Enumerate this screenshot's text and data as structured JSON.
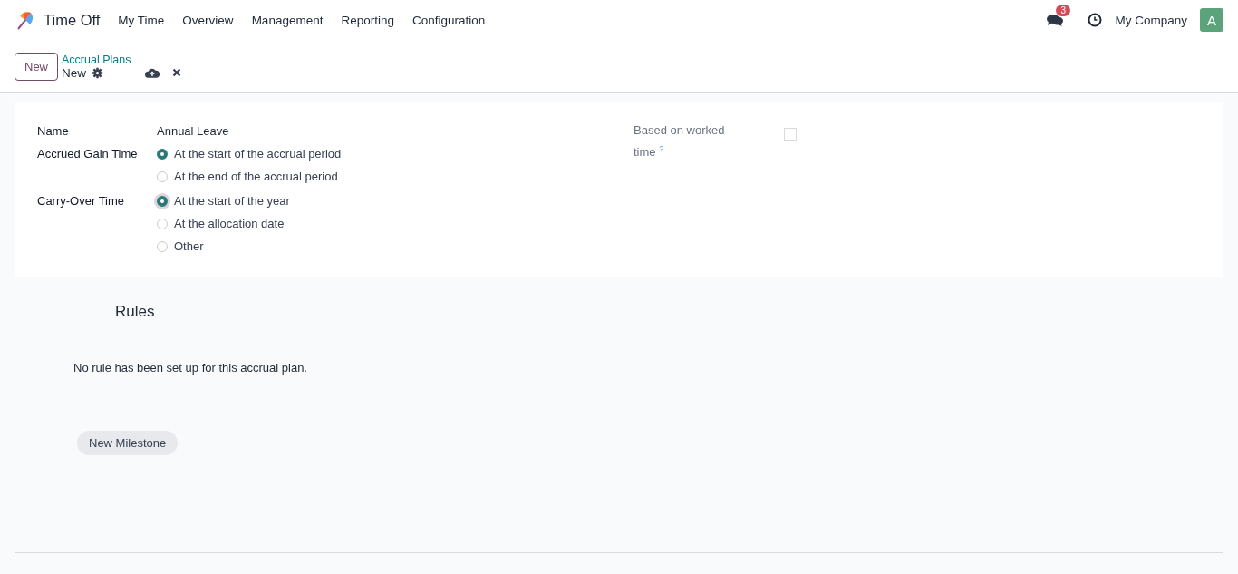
{
  "navbar": {
    "app_name": "Time Off",
    "menu": [
      "My Time",
      "Overview",
      "Management",
      "Reporting",
      "Configuration"
    ],
    "messages_badge": "3",
    "company": "My Company",
    "avatar_letter": "A"
  },
  "control_panel": {
    "new_button": "New",
    "breadcrumb": "Accrual Plans",
    "record_title": "New"
  },
  "form": {
    "name_label": "Name",
    "name_value": "Annual Leave",
    "groups": [
      {
        "label": "Accrued Gain Time",
        "focused": false,
        "options": [
          {
            "label": "At the start of the accrual period",
            "selected": true
          },
          {
            "label": "At the end of the accrual period",
            "selected": false
          }
        ]
      },
      {
        "label": "Carry-Over Time",
        "focused": true,
        "options": [
          {
            "label": "At the start of the year",
            "selected": true
          },
          {
            "label": "At the allocation date",
            "selected": false
          },
          {
            "label": "Other",
            "selected": false
          }
        ]
      }
    ],
    "worked_time": {
      "label_line1": "Based on worked",
      "label_line2": "time",
      "help": "?",
      "checked": false
    }
  },
  "rules": {
    "title": "Rules",
    "empty_text": "No rule has been set up for this accrual plan.",
    "add_button": "New Milestone"
  }
}
